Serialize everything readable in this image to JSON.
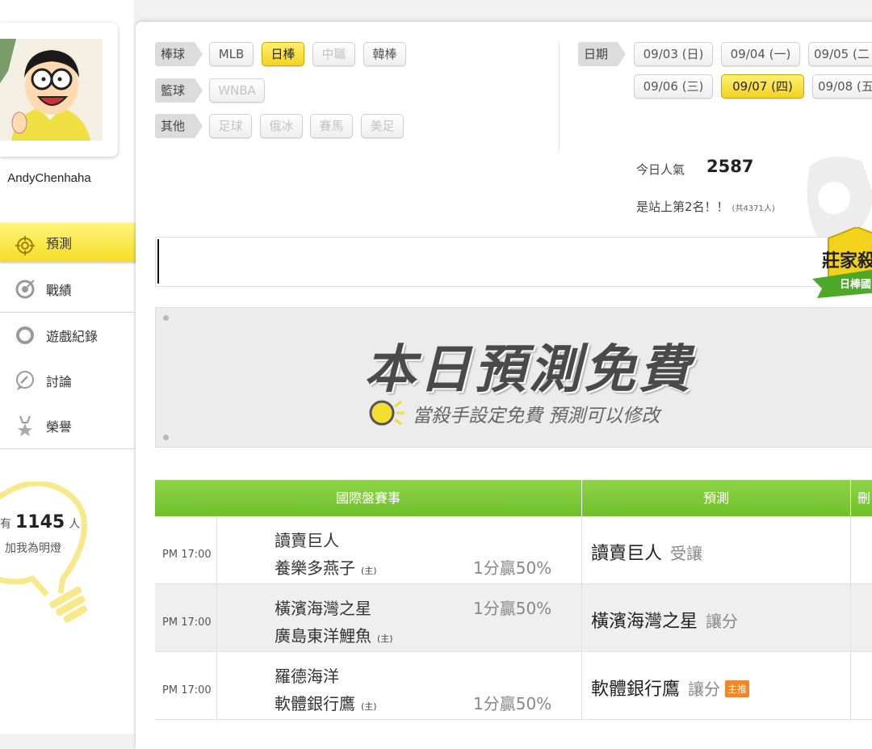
{
  "user": {
    "name": "AndyChenhaha"
  },
  "nav": [
    {
      "label": "預測",
      "active": true,
      "icon": "target-icon"
    },
    {
      "label": "戰績",
      "active": false,
      "icon": "trophy-target-icon"
    },
    {
      "label": "遊戲紀錄",
      "active": false,
      "icon": "circle-icon"
    },
    {
      "label": "討論",
      "active": false,
      "icon": "chat-icon"
    },
    {
      "label": "榮譽",
      "active": false,
      "icon": "medal-icon"
    }
  ],
  "lamp": {
    "prefix": "有",
    "count": "1145",
    "unit": "人",
    "suffix": "加我為明燈"
  },
  "filters": {
    "baseball": {
      "label": "棒球",
      "chips": [
        "MLB",
        "日棒",
        "中職",
        "韓棒"
      ]
    },
    "basketball": {
      "label": "籃球",
      "chips": [
        "WNBA"
      ]
    },
    "other": {
      "label": "其他",
      "chips": [
        "足球",
        "俄冰",
        "賽馬",
        "美足"
      ]
    }
  },
  "dates": {
    "label": "日期",
    "row1": [
      "09/03 (日)",
      "09/04 (一)",
      "09/05 (二"
    ],
    "row2": [
      "09/06 (三)",
      "09/07 (四)",
      "09/08 (五"
    ]
  },
  "popularity": {
    "label": "今日人氣",
    "value": "2587",
    "rank_text": "是站上第2名！！",
    "rank_small": "(共4371人)"
  },
  "badge": {
    "title": "莊家殺",
    "sub": "日棒國"
  },
  "banner": {
    "title": "本日預測免費",
    "subtitle": "當殺手設定免費  預測可以修改"
  },
  "table": {
    "headers": [
      "國際盤賽事",
      "預測",
      "刪"
    ],
    "home_mark": "(主)",
    "rows": [
      {
        "time": "PM 17:00",
        "team1": "讀賣巨人",
        "team2": "養樂多燕子",
        "home_on": 2,
        "odds": "1分贏50%",
        "odds_row": 2,
        "pick": "讀賣巨人",
        "pick_type": "受讓",
        "tag": ""
      },
      {
        "time": "PM 17:00",
        "team1": "橫濱海灣之星",
        "team2": "廣島東洋鯉魚",
        "home_on": 2,
        "odds": "1分贏50%",
        "odds_row": 1,
        "pick": "橫濱海灣之星",
        "pick_type": "讓分",
        "tag": ""
      },
      {
        "time": "PM 17:00",
        "team1": "羅德海洋",
        "team2": "軟體銀行鷹",
        "home_on": 2,
        "odds": "1分贏50%",
        "odds_row": 2,
        "pick": "軟體銀行鷹",
        "pick_type": "讓分",
        "tag": "主推"
      }
    ]
  },
  "colors": {
    "accent_yellow": "#f5dd26",
    "header_green": "#7cc836",
    "tag_orange": "#f0852a"
  }
}
